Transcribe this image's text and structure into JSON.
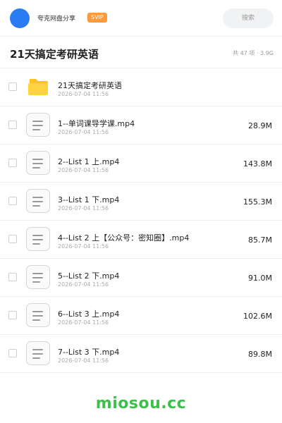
{
  "header": {
    "brand": "夸克网盘分享",
    "badge": "SVIP",
    "search_placeholder": "搜索"
  },
  "folder": {
    "title": "21天搞定考研英语",
    "meta": "共 47 项 · 3.9G"
  },
  "items": [
    {
      "name": "21天搞定考研英语",
      "date": "2026-07-04 11:56",
      "size": "",
      "type": "folder"
    },
    {
      "name": "1--单词课导学课.mp4",
      "date": "2026-07-04 11:56",
      "size": "28.9M",
      "type": "file"
    },
    {
      "name": "2--List 1 上.mp4",
      "date": "2026-07-04 11:56",
      "size": "143.8M",
      "type": "file"
    },
    {
      "name": "3--List 1 下.mp4",
      "date": "2026-07-04 11:56",
      "size": "155.3M",
      "type": "file"
    },
    {
      "name": "4--List 2 上【公众号：密知圈】.mp4",
      "date": "2026-07-04 11:56",
      "size": "85.7M",
      "type": "file"
    },
    {
      "name": "5--List 2 下.mp4",
      "date": "2026-07-04 11:56",
      "size": "91.0M",
      "type": "file"
    },
    {
      "name": "6--List 3 上.mp4",
      "date": "2026-07-04 11:56",
      "size": "102.6M",
      "type": "file"
    },
    {
      "name": "7--List 3 下.mp4",
      "date": "2026-07-04 11:56",
      "size": "89.8M",
      "type": "file"
    }
  ],
  "watermark": "miosou.cc",
  "colors": {
    "accent": "#2b7cf3",
    "svip": "#ff9a3c",
    "folder": "#ffc21a",
    "watermark": "#3cbf4b"
  }
}
